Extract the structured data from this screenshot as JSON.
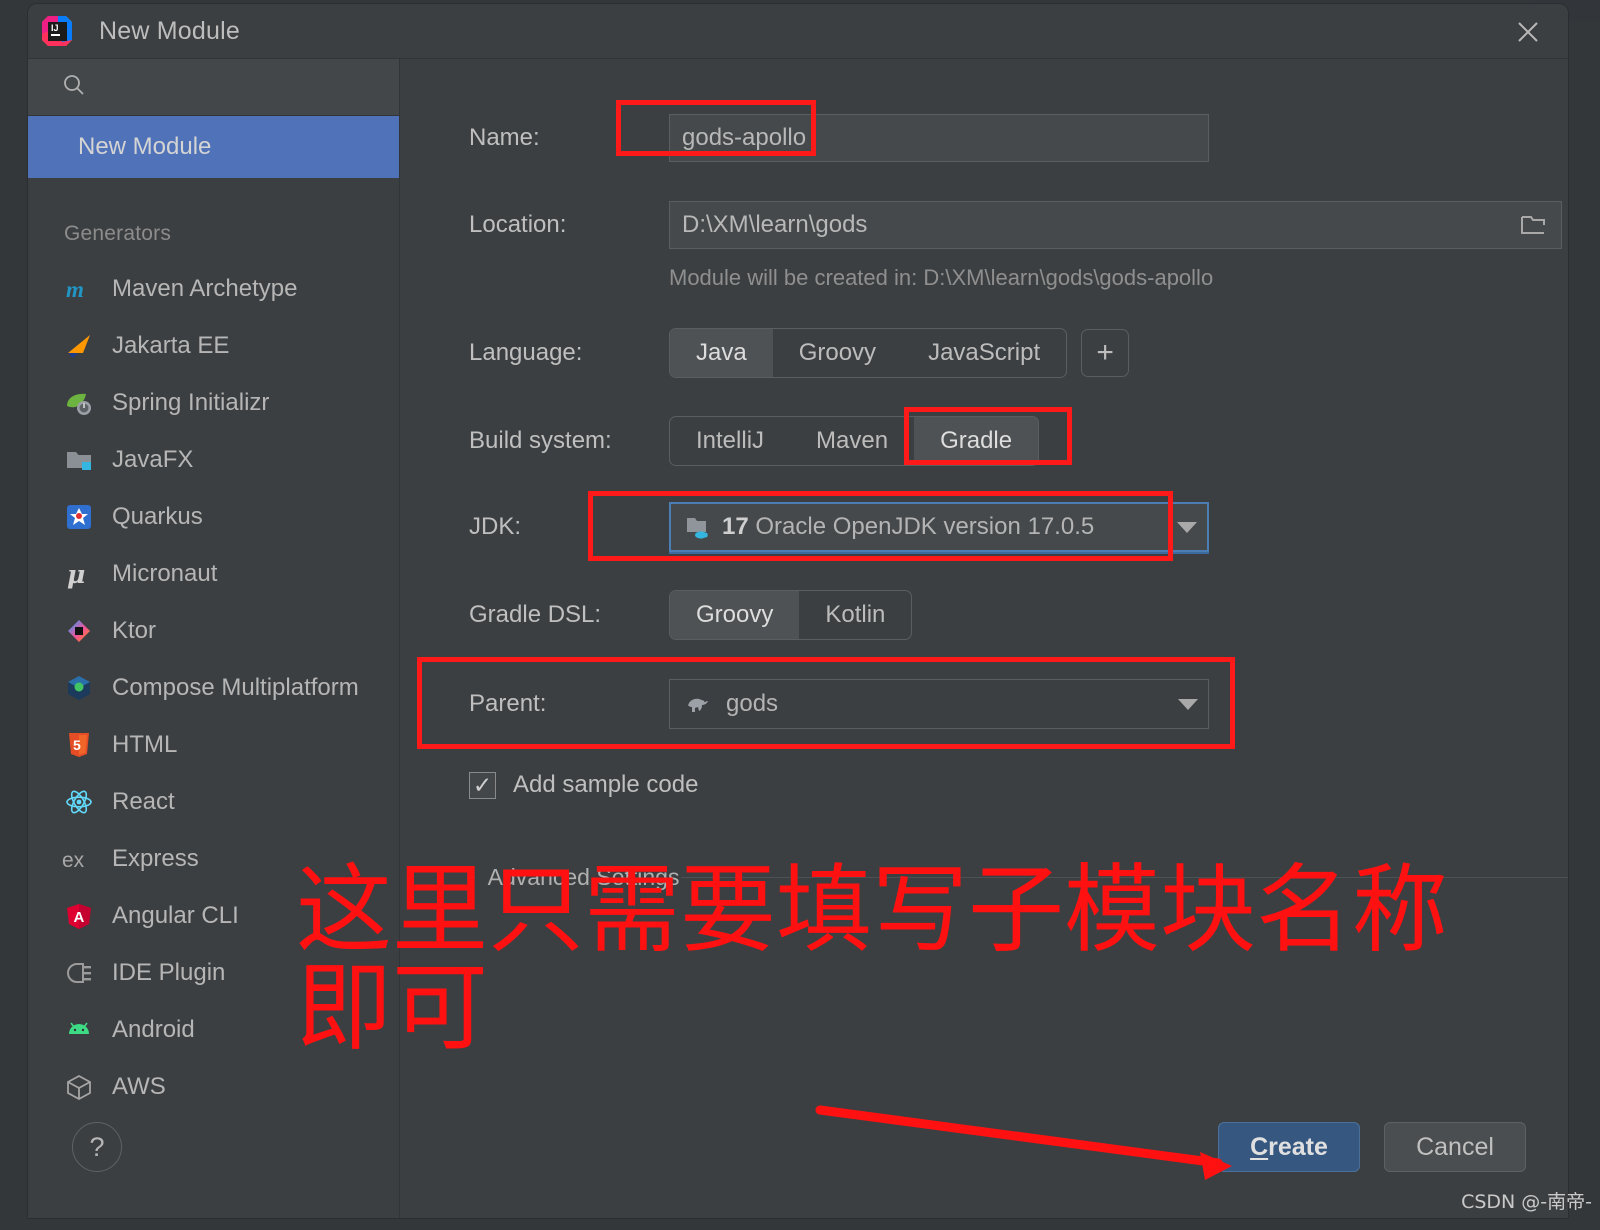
{
  "window": {
    "title": "New Module",
    "logo_icon": "intellij-idea-logo",
    "close_icon": "close-icon",
    "background_bleed_text": "...."
  },
  "sidebar": {
    "search": {
      "value": "",
      "placeholder": "",
      "icon": "search-icon"
    },
    "selected_item": "New Module",
    "generators_header": "Generators",
    "items": [
      {
        "label": "Maven Archetype",
        "icon": "maven-icon"
      },
      {
        "label": "Jakarta EE",
        "icon": "jakarta-ee-icon"
      },
      {
        "label": "Spring Initializr",
        "icon": "spring-icon"
      },
      {
        "label": "JavaFX",
        "icon": "javafx-icon"
      },
      {
        "label": "Quarkus",
        "icon": "quarkus-icon"
      },
      {
        "label": "Micronaut",
        "icon": "micronaut-icon"
      },
      {
        "label": "Ktor",
        "icon": "ktor-icon"
      },
      {
        "label": "Compose Multiplatform",
        "icon": "compose-icon"
      },
      {
        "label": "HTML",
        "icon": "html5-icon"
      },
      {
        "label": "React",
        "icon": "react-icon"
      },
      {
        "label": "Express",
        "icon": "express-icon"
      },
      {
        "label": "Angular CLI",
        "icon": "angular-icon"
      },
      {
        "label": "IDE Plugin",
        "icon": "plugin-icon"
      },
      {
        "label": "Android",
        "icon": "android-icon"
      },
      {
        "label": "AWS",
        "icon": "aws-icon"
      }
    ]
  },
  "form": {
    "name": {
      "label": "Name:",
      "value": "gods-apollo"
    },
    "location": {
      "label": "Location:",
      "value": "D:\\XM\\learn\\gods",
      "browse_icon": "folder-open-icon"
    },
    "location_hint": "Module will be created in: D:\\XM\\learn\\gods\\gods-apollo",
    "language": {
      "label": "Language:",
      "options": [
        "Java",
        "Groovy",
        "JavaScript"
      ],
      "selected": "Java",
      "add_label": "+"
    },
    "build_system": {
      "label": "Build system:",
      "options": [
        "IntelliJ",
        "Maven",
        "Gradle"
      ],
      "selected": "Gradle"
    },
    "jdk": {
      "label": "JDK:",
      "version": "17",
      "description": "Oracle OpenJDK version 17.0.5",
      "icon": "jdk-folder-icon",
      "dropdown_icon": "chevron-down-icon"
    },
    "gradle_dsl": {
      "label": "Gradle DSL:",
      "options": [
        "Groovy",
        "Kotlin"
      ],
      "selected": "Groovy"
    },
    "parent": {
      "label": "Parent:",
      "value": "gods",
      "icon": "gradle-elephant-icon",
      "dropdown_icon": "chevron-down-icon"
    },
    "add_sample_code": {
      "label": "Add sample code",
      "checked": true,
      "check_glyph": "✓"
    },
    "advanced_settings": {
      "label": "Advanced Settings",
      "chevron": "›",
      "expanded": false
    }
  },
  "footer": {
    "help_label": "?",
    "create_label_prefix": "",
    "create_label_underlined": "C",
    "create_label_rest": "reate",
    "cancel_label": "Cancel"
  },
  "annotations": {
    "line1": "这里只需要填写子模块名称",
    "line2": "即可",
    "color": "#ff1111",
    "highlight_boxes": [
      "name-field",
      "gradle-build-option",
      "jdk-combo",
      "parent-row"
    ],
    "arrow_target": "create-button"
  },
  "watermark": "CSDN @-南帝-"
}
